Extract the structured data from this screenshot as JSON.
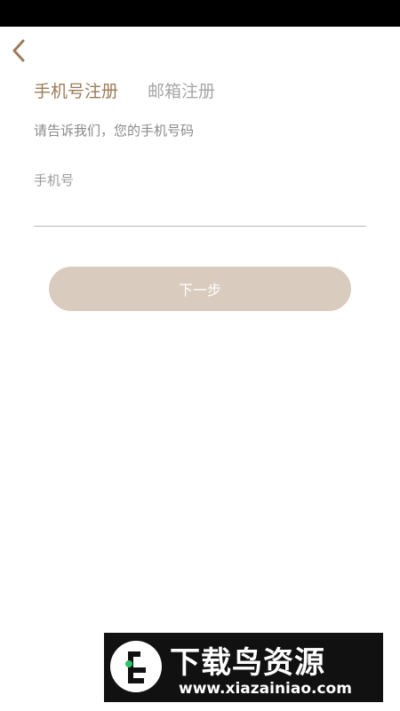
{
  "header": {
    "back_icon": "chevron-left-icon"
  },
  "tabs": [
    {
      "label": "手机号注册",
      "active": true
    },
    {
      "label": "邮箱注册",
      "active": false
    }
  ],
  "form": {
    "subtitle": "请告诉我们，您的手机号码",
    "phone_label": "手机号",
    "phone_value": "",
    "phone_placeholder": ""
  },
  "next_button": {
    "label": "下一步"
  },
  "watermark": {
    "name": "下载鸟资源",
    "url": "www.xiazainiao.com"
  },
  "colors": {
    "accent": "#9d7b58",
    "button_bg": "#d9cbbd",
    "status_bar": "#000000"
  }
}
